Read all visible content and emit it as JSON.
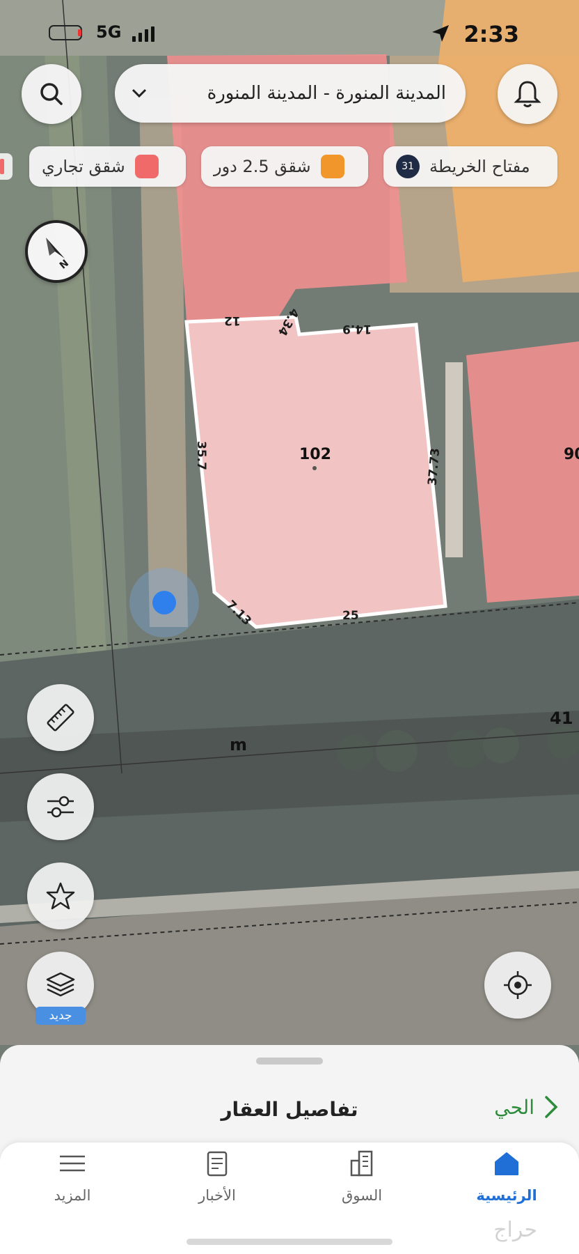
{
  "status_bar": {
    "network": "5G",
    "time": "2:33"
  },
  "header": {
    "city_selector": "المدينة المنورة - المدينة المنورة"
  },
  "legend_chips": [
    {
      "label": "مفتاح الخريطة",
      "count": "31",
      "color": "#1f2a44"
    },
    {
      "label": "شقق 2.5 دور",
      "color": "#f0962a"
    },
    {
      "label": "شقق تجاري",
      "color": "#f06a6a"
    }
  ],
  "map": {
    "plot_number": "102",
    "neighbor_plot": "90",
    "street_label": "m",
    "street_number": "41",
    "dimensions": {
      "top_left": "12",
      "top_small": "4.34",
      "top_right": "14.9",
      "left": "35.7",
      "right": "37.73",
      "bottom": "25",
      "corner": "7.13"
    }
  },
  "layers_badge": "جديد",
  "sheet": {
    "title": "تفاصيل العقار",
    "neighborhood_link": "الحي"
  },
  "tabs": [
    {
      "label": "الرئيسية",
      "active": true,
      "icon": "home-icon"
    },
    {
      "label": "السوق",
      "active": false,
      "icon": "buildings-icon"
    },
    {
      "label": "الأخبار",
      "active": false,
      "icon": "news-icon"
    },
    {
      "label": "المزيد",
      "active": false,
      "icon": "menu-icon"
    }
  ],
  "watermark": "حراج",
  "colors": {
    "accent": "#1f6fd6",
    "plot_fill": "#f2b8b8",
    "commercial": "#f06a6a",
    "apartments": "#f0962a",
    "link": "#2d8b3b"
  }
}
